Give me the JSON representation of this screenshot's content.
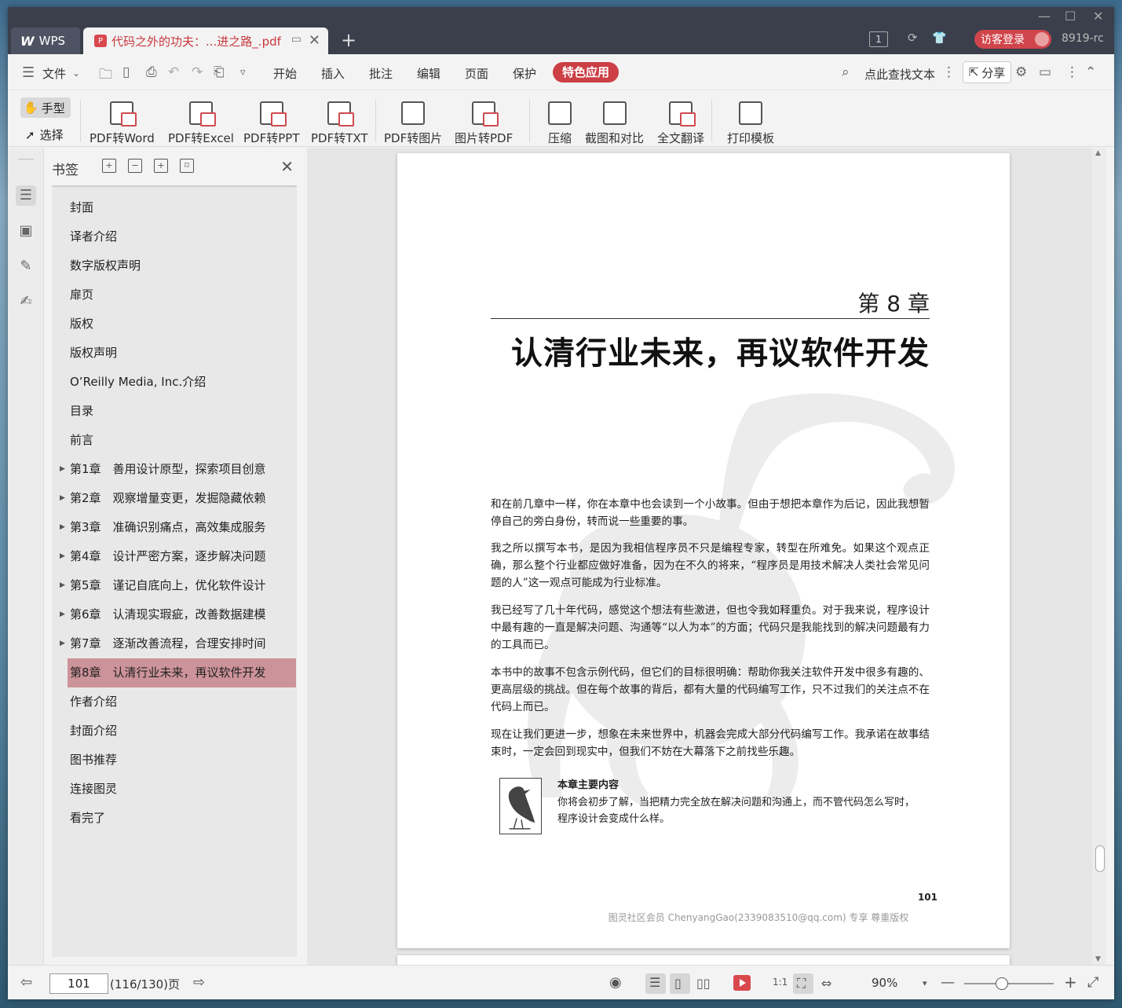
{
  "titlebar": {
    "app_tab": "WPS",
    "doc_tab": "代码之外的功夫：...进之路_.pdf",
    "tab_count": "1",
    "login": "访客登录",
    "user_id": "8919-rc"
  },
  "menu": {
    "file": "文件",
    "items": [
      "开始",
      "插入",
      "批注",
      "编辑",
      "页面",
      "保护"
    ],
    "special": "特色应用",
    "search": "点此查找文本",
    "share": "分享"
  },
  "ribbon": {
    "hand": "手型",
    "select": "选择",
    "tools": [
      "PDF转Word",
      "PDF转Excel",
      "PDF转PPT",
      "PDF转TXT",
      "PDF转图片",
      "图片转PDF",
      "压缩",
      "截图和对比",
      "全文翻译",
      "打印模板"
    ]
  },
  "bookmarks": {
    "title": "书签",
    "items": [
      {
        "label": "封面",
        "expandable": false
      },
      {
        "label": "译者介绍",
        "expandable": false
      },
      {
        "label": "数字版权声明",
        "expandable": false
      },
      {
        "label": "扉页",
        "expandable": false
      },
      {
        "label": "版权",
        "expandable": false
      },
      {
        "label": "版权声明",
        "expandable": false
      },
      {
        "label": "O’Reilly Media, Inc.介绍",
        "expandable": false
      },
      {
        "label": "目录",
        "expandable": false
      },
      {
        "label": "前言",
        "expandable": false
      },
      {
        "label": "第1章　善用设计原型，探索项目创意",
        "expandable": true
      },
      {
        "label": "第2章　观察增量变更，发掘隐藏依赖",
        "expandable": true
      },
      {
        "label": "第3章　准确识别痛点，高效集成服务",
        "expandable": true
      },
      {
        "label": "第4章　设计严密方案，逐步解决问题",
        "expandable": true
      },
      {
        "label": "第5章　谨记自底向上，优化软件设计",
        "expandable": true
      },
      {
        "label": "第6章　认清现实瑕疵，改善数据建模",
        "expandable": true
      },
      {
        "label": "第7章　逐渐改善流程，合理安排时间",
        "expandable": true
      },
      {
        "label": "第8章　认清行业未来，再议软件开发",
        "expandable": false,
        "active": true
      },
      {
        "label": "作者介绍",
        "expandable": false
      },
      {
        "label": "封面介绍",
        "expandable": false
      },
      {
        "label": "图书推荐",
        "expandable": false
      },
      {
        "label": "连接图灵",
        "expandable": false
      },
      {
        "label": "看完了",
        "expandable": false
      }
    ]
  },
  "document": {
    "chapter_number": "第 8 章",
    "chapter_title": "认清行业未来，再议软件开发",
    "paragraphs": [
      "和在前几章中一样，你在本章中也会读到一个小故事。但由于想把本章作为后记，因此我想暂停自己的旁白身份，转而说一些重要的事。",
      "我之所以撰写本书，是因为我相信程序员不只是编程专家，转型在所难免。如果这个观点正确，那么整个行业都应做好准备，因为在不久的将来，“程序员是用技术解决人类社会常见问题的人”这一观点可能成为行业标准。",
      "我已经写了几十年代码，感觉这个想法有些激进，但也令我如释重负。对于我来说，程序设计中最有趣的一直是解决问题、沟通等“以人为本”的方面；代码只是我能找到的解决问题最有力的工具而已。",
      "本书中的故事不包含示例代码，但它们的目标很明确：帮助你我关注软件开发中很多有趣的、更高层级的挑战。但在每个故事的背后，都有大量的代码编写工作，只不过我们的关注点不在代码上而已。",
      "现在让我们更进一步，想象在未来世界中，机器会完成大部分代码编写工作。我承诺在故事结束时，一定会回到现实中，但我们不妨在大幕落下之前找些乐趣。"
    ],
    "note_title": "本章主要内容",
    "note_text": "你将会初步了解，当把精力完全放在解决问题和沟通上，而不管代码怎么写时，程序设计会变成什么样。",
    "page_number": "101",
    "watermark": "图灵社区会员 ChenyangGao(2339083510@qq.com) 专享 尊重版权"
  },
  "status": {
    "current_page": "101",
    "page_count": "(116/130)页",
    "zoom": "90%"
  },
  "colors": {
    "accent": "#cc3f45",
    "titlebar": "#3a3f4b",
    "bookmark_active": "#cd939a"
  }
}
